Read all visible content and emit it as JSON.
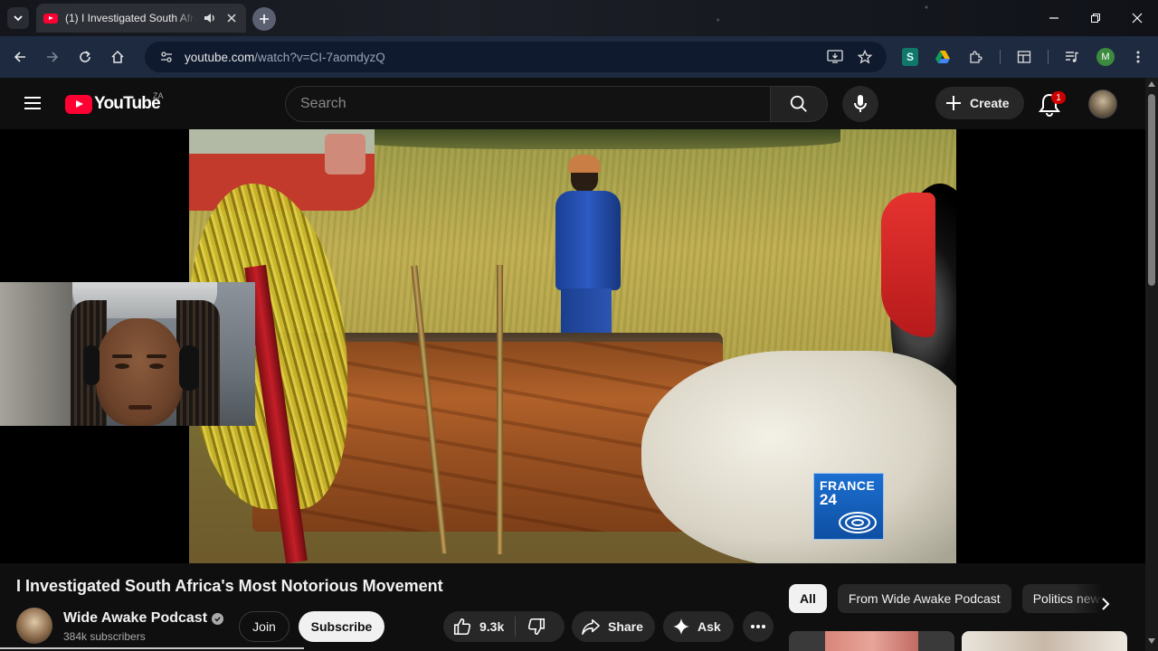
{
  "browser": {
    "tab": {
      "title": "(1) I Investigated South Africa's Most Notorious Movement",
      "favicon": "youtube-favicon",
      "audio_icon": "speaker-icon"
    },
    "url": {
      "host": "youtube.com",
      "path": "/watch?v=CI-7aomdyzQ"
    },
    "profile_initial": "M",
    "extension_s_label": "S"
  },
  "masthead": {
    "logo_text": "YouTube",
    "country_code": "ZA",
    "search_placeholder": "Search",
    "create_label": "Create",
    "notification_count": "1"
  },
  "player": {
    "watermark_line1": "FRANCE",
    "watermark_line2": "24"
  },
  "video": {
    "title": "I Investigated South Africa's Most Notorious Movement",
    "channel_name": "Wide Awake Podcast",
    "subscribers": "384k subscribers",
    "join_label": "Join",
    "subscribe_label": "Subscribe",
    "like_count": "9.3k",
    "share_label": "Share",
    "ask_label": "Ask"
  },
  "chips": [
    "All",
    "From Wide Awake Podcast",
    "Politics news"
  ],
  "colors": {
    "background": "#0f0f0f",
    "brand_red": "#ff0033",
    "toolbar": "#1e2a40"
  }
}
